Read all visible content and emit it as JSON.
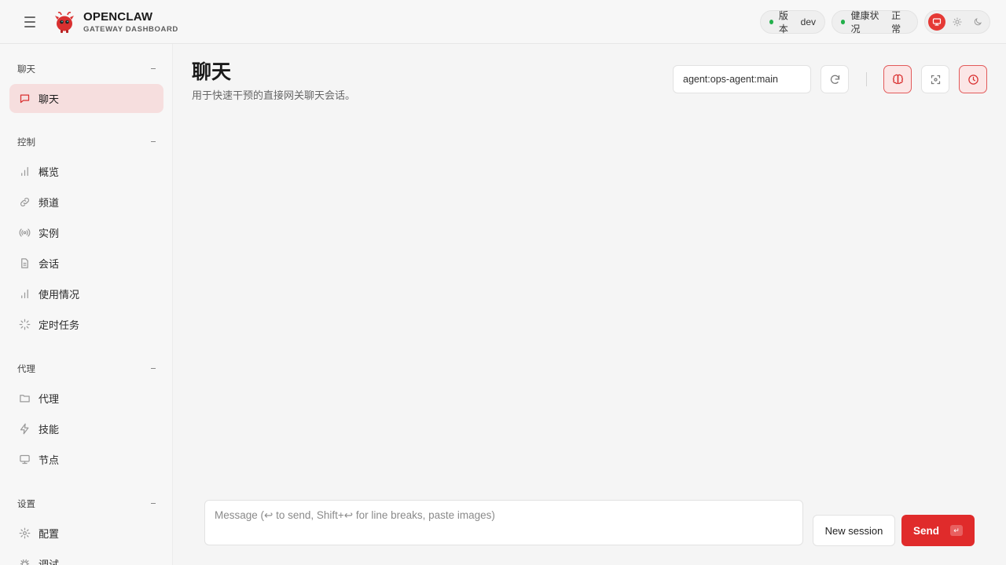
{
  "colors": {
    "accent": "#e02b2b",
    "status_ok": "#22b04b",
    "active_nav_bg": "#f6dede"
  },
  "header": {
    "brand_title": "OPENCLAW",
    "brand_subtitle": "GATEWAY DASHBOARD",
    "version_label": "版本",
    "version_value": "dev",
    "health_label": "健康状况",
    "health_value": "正常",
    "theme_options": [
      "monitor-icon",
      "sun-icon",
      "moon-icon"
    ]
  },
  "sidebar": {
    "groups": [
      {
        "label": "聊天",
        "items": [
          {
            "label": "聊天",
            "icon": "message-icon",
            "active": true
          }
        ]
      },
      {
        "label": "控制",
        "items": [
          {
            "label": "概览",
            "icon": "bar-chart-icon"
          },
          {
            "label": "频道",
            "icon": "link-icon"
          },
          {
            "label": "实例",
            "icon": "radio-icon"
          },
          {
            "label": "会话",
            "icon": "file-text-icon"
          },
          {
            "label": "使用情况",
            "icon": "bar-chart-icon"
          },
          {
            "label": "定时任务",
            "icon": "loader-icon"
          }
        ]
      },
      {
        "label": "代理",
        "items": [
          {
            "label": "代理",
            "icon": "folder-icon"
          },
          {
            "label": "技能",
            "icon": "zap-icon"
          },
          {
            "label": "节点",
            "icon": "monitor-icon"
          }
        ]
      },
      {
        "label": "设置",
        "items": [
          {
            "label": "配置",
            "icon": "settings-icon"
          },
          {
            "label": "调试",
            "icon": "bug-icon"
          }
        ]
      }
    ]
  },
  "main": {
    "title": "聊天",
    "subtitle": "用于快速干预的直接网关聊天会话。",
    "session_value": "agent:ops-agent:main",
    "toolbar_icons": [
      "refresh-icon",
      "brain-icon",
      "focus-icon",
      "clock-icon"
    ]
  },
  "composer": {
    "placeholder": "Message (↩ to send, Shift+↩ for line breaks, paste images)",
    "new_session_label": "New session",
    "send_label": "Send",
    "send_shortcut": "↵"
  }
}
